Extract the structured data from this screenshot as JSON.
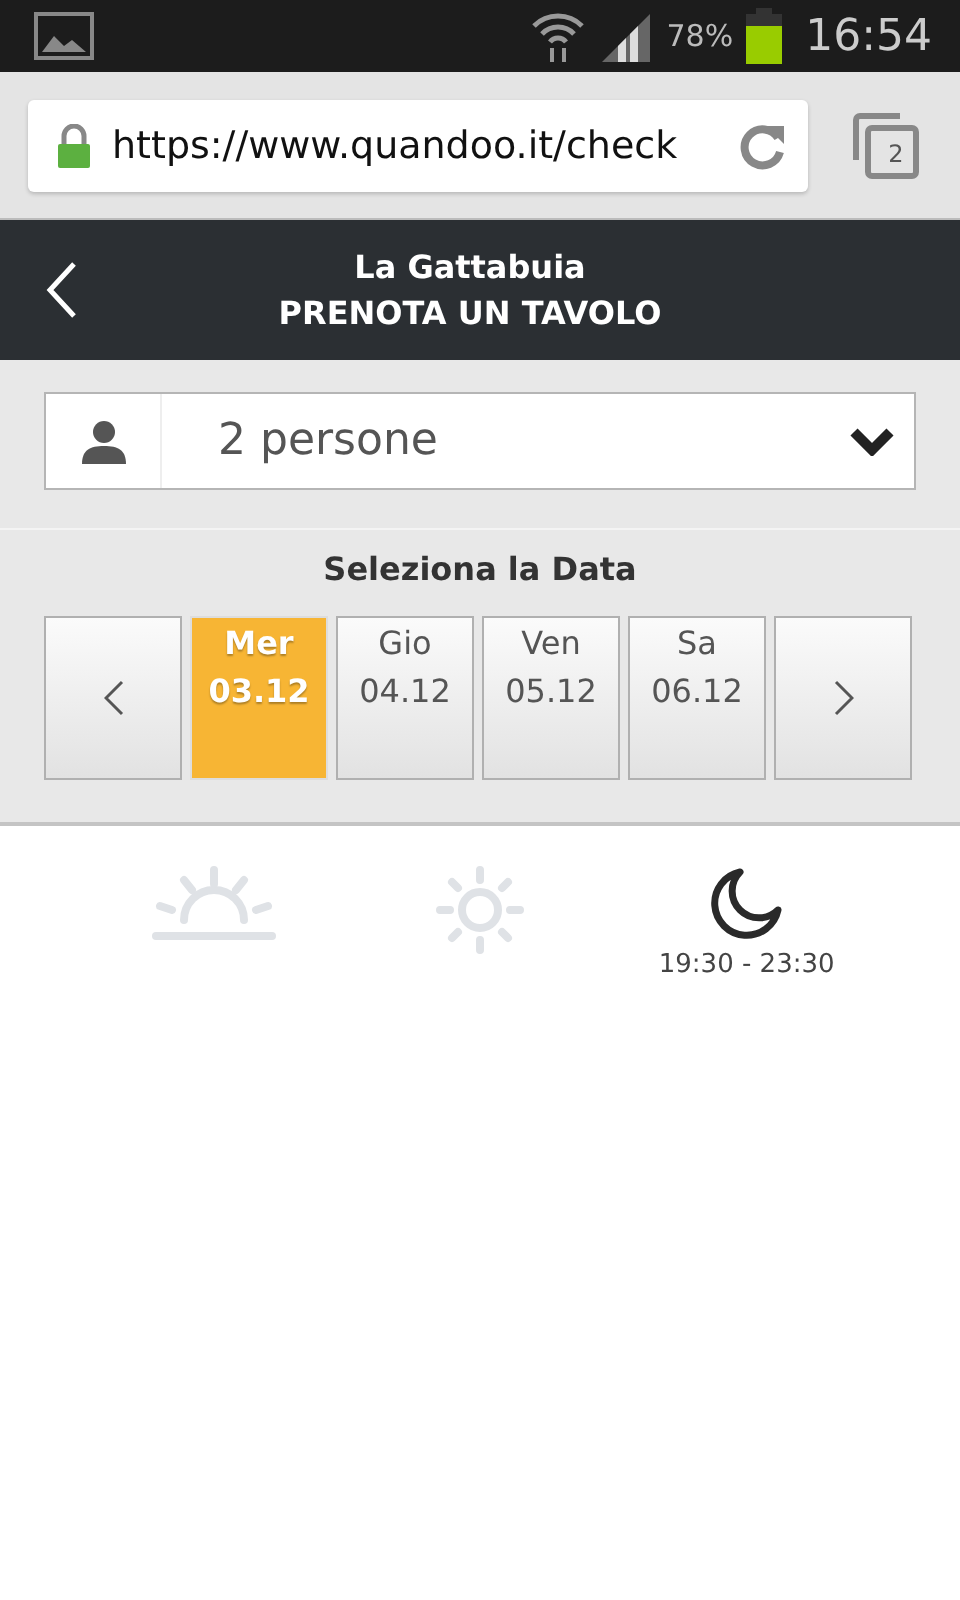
{
  "status_bar": {
    "battery_percent": "78%",
    "time": "16:54"
  },
  "browser": {
    "url": "https://www.quandoo.it/check",
    "tab_count": "2"
  },
  "header": {
    "title": "La Gattabuia",
    "subtitle": "PRENOTA UN TAVOLO"
  },
  "party_select": {
    "value": "2 persone"
  },
  "date_picker": {
    "label": "Seleziona la Data",
    "dates": [
      {
        "day": "Mer",
        "date": "03.12",
        "selected": true
      },
      {
        "day": "Gio",
        "date": "04.12",
        "selected": false
      },
      {
        "day": "Ven",
        "date": "05.12",
        "selected": false
      },
      {
        "day": "Sa",
        "date": "06.12",
        "selected": false
      }
    ]
  },
  "meal_slots": [
    {
      "kind": "morning",
      "available": false
    },
    {
      "kind": "midday",
      "available": false
    },
    {
      "kind": "evening",
      "available": true,
      "hours": "19:30 - 23:30"
    }
  ]
}
